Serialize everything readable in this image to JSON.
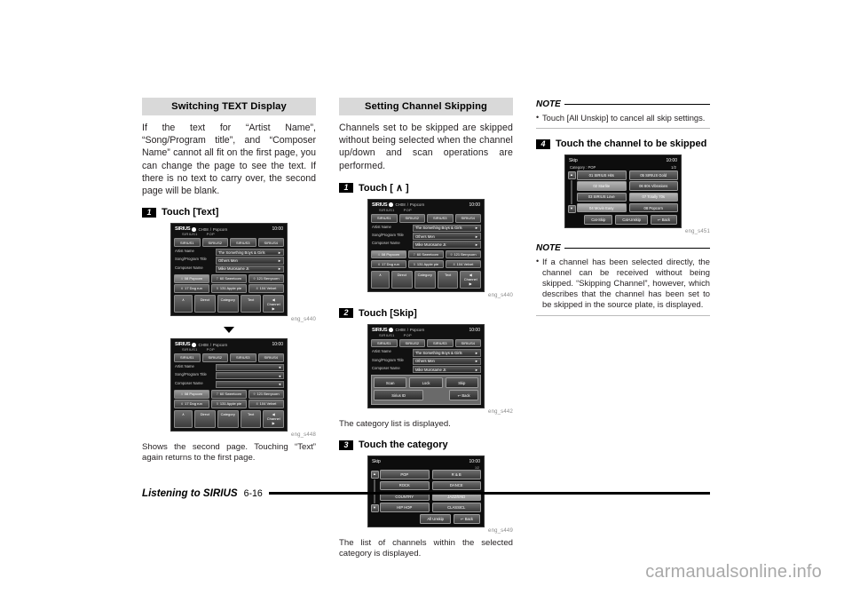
{
  "col1": {
    "heading": "Switching TEXT Display",
    "intro": "If the text for “Artist Name”, “Song/Program title”, and “Composer Name” cannot all fit on the first page, you can change the page to see the text. If there is no text to carry over, the second page will be blank.",
    "step1": {
      "num": "1",
      "label": "Touch [Text]"
    },
    "shot1_id": "eng_s440",
    "shot2_id": "eng_s448",
    "caption": "Shows the second page. Touching “Text” again returns to the first page."
  },
  "col2": {
    "heading": "Setting Channel Skipping",
    "intro": "Channels set to be skipped are skipped without being selected when the channel up/down and scan operations are performed.",
    "step1": {
      "num": "1",
      "label": "Touch [ ∧ ]"
    },
    "shot1_id": "eng_s440",
    "step2": {
      "num": "2",
      "label": "Touch [Skip]"
    },
    "shot2_id": "eng_s442",
    "caption2": "The category list is displayed.",
    "step3": {
      "num": "3",
      "label": "Touch the category"
    },
    "shot3_id": "eng_s449",
    "caption3": "The list of channels within the selected category is displayed."
  },
  "col3": {
    "note1": {
      "title": "NOTE",
      "items": [
        "Touch [All Unskip] to cancel all skip settings."
      ]
    },
    "step4": {
      "num": "4",
      "label": "Touch the channel to be skipped"
    },
    "shot4_id": "eng_s451",
    "note2": {
      "title": "NOTE",
      "items": [
        "If a channel has been selected directly, the channel can be received without being skipped. “Skipping Channel”, however, which describes that the channel has been set to be skipped in the source plate, is displayed."
      ]
    }
  },
  "radio": {
    "brand": "SIRIUS",
    "channel_label": "CH08",
    "channel_name": "Popcorn",
    "preset_id": "SIRIUS1",
    "genre": "POP",
    "clock": "10:00",
    "presets": [
      "SIRIUS1",
      "SIRIUS2",
      "SIRIUS3",
      "SIRIUS4"
    ],
    "info_labels": [
      "Artist Name",
      "Song/Program Title",
      "Composer Name"
    ],
    "info_values_page1": [
      "The Something Boys & Girls",
      "Others Men",
      "Mike Murosame Jr."
    ],
    "info_values_page2": [
      "",
      "",
      ""
    ],
    "grid": [
      [
        {
          "num": "4",
          "label": "08 Popcorn",
          "sel": true
        },
        {
          "num": "7",
          "label": "60 Sweetcorn",
          "sel": false
        },
        {
          "num": "9",
          "label": "121 Berrycorn",
          "sel": false
        }
      ],
      [
        {
          "num": "6",
          "label": "17 Dog run",
          "sel": false
        },
        {
          "num": "5",
          "label": "131 Apple pie",
          "sel": false
        },
        {
          "num": "8",
          "label": "104 Velvet",
          "sel": false
        }
      ]
    ],
    "controls": [
      "∧",
      "Direct",
      "Category",
      "Text",
      "◀ Channel ▶"
    ]
  },
  "skip_popup": {
    "row1": [
      "Scan",
      "Lock",
      "Skip"
    ],
    "row2": [
      "Sirius ID",
      "↩ Back"
    ]
  },
  "category_screen": {
    "title": "Skip",
    "clock": "10:00",
    "pageno": "1/2",
    "rows": [
      [
        {
          "label": "POP",
          "sel": false
        },
        {
          "label": "R & B",
          "sel": false
        }
      ],
      [
        {
          "label": "ROCK",
          "sel": false
        },
        {
          "label": "DANCE",
          "sel": false
        }
      ],
      [
        {
          "label": "COUNTRY",
          "sel": false
        },
        {
          "label": "JAZZ/END",
          "sel": true
        }
      ],
      [
        {
          "label": "HIP HOP",
          "sel": false
        },
        {
          "label": "CLASSICL",
          "sel": false
        }
      ]
    ],
    "footer": [
      "All Unskip",
      "↩ Back"
    ],
    "scroll_up": "▲",
    "scroll_down": "▼"
  },
  "channel_screen": {
    "title": "Skip",
    "clock": "10:00",
    "category_line": "Category : POP",
    "pageno": "1/2",
    "rows": [
      [
        {
          "label": "01 SIRIUS Hits",
          "sel": false
        },
        {
          "label": "05 SIRIUS Gold",
          "sel": false
        }
      ],
      [
        {
          "label": "02 Starlite",
          "sel": true
        },
        {
          "label": "06 80s Vibrations",
          "sel": false
        }
      ],
      [
        {
          "label": "03 SIRIUS Love",
          "sel": false
        },
        {
          "label": "07 Totally 70s",
          "sel": true
        }
      ],
      [
        {
          "label": "04 Movin Easy",
          "sel": true
        },
        {
          "label": "08 Popcorn",
          "sel": false
        }
      ]
    ],
    "footer": [
      "Cat-Skip",
      "Cat-Unskip",
      "↩ Back"
    ],
    "scroll_up": "▲",
    "scroll_down": "▼"
  },
  "footer": {
    "section_title": "Listening to SIRIUS",
    "page": "6-16"
  },
  "watermark": "carmanualsonline.info"
}
